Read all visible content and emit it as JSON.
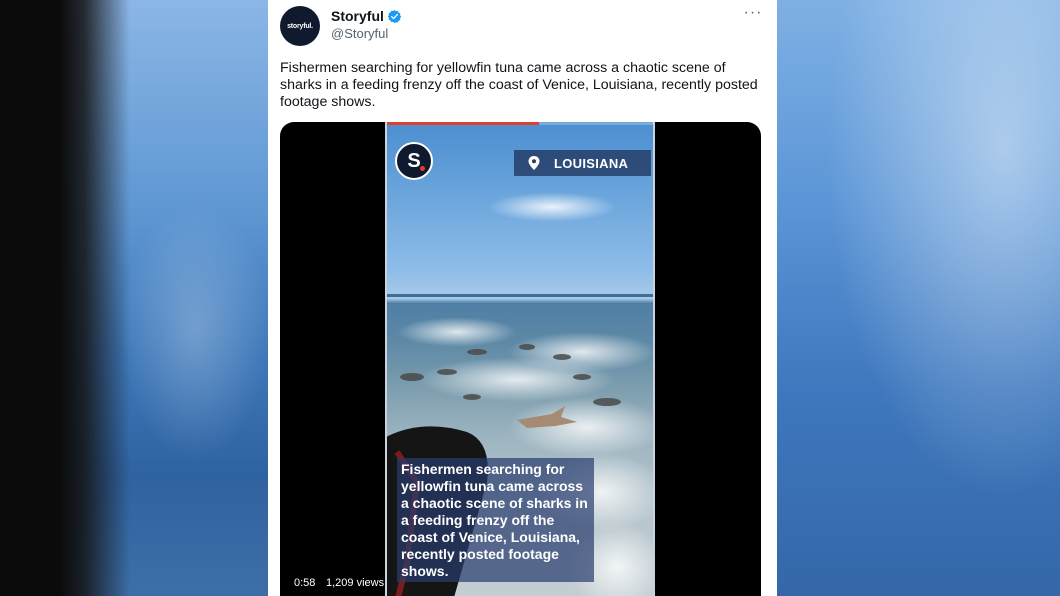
{
  "account": {
    "display_name": "Storyful",
    "handle": "@Storyful",
    "avatar_text": "storyful.",
    "verified": true,
    "verified_color": "#1d9bf0"
  },
  "tweet": {
    "text": "Fishermen searching for yellowfin tuna came across a chaotic scene of sharks in a feeding frenzy off the coast of Venice, Louisiana, recently posted footage shows.",
    "more_icon": "more-horizontal-icon"
  },
  "video": {
    "logo_letter": "S",
    "location_icon": "map-pin-icon",
    "location": "LOUISIANA",
    "caption": "Fishermen searching for yellowfin tuna came across a chaotic scene of sharks in a feeding frenzy off the coast of Venice, Louisiana, recently posted footage shows.",
    "duration": "0:58",
    "views": "1,209 views",
    "progress_fraction": 0.57,
    "progress_color": "#e0412f"
  }
}
